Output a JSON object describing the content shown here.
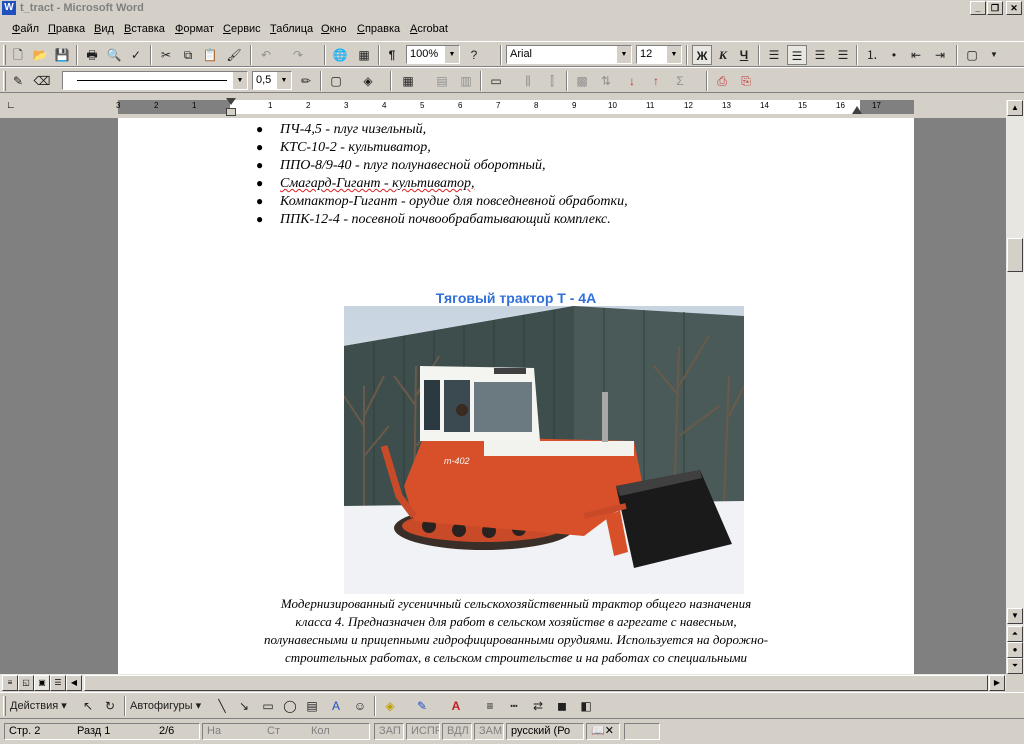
{
  "window": {
    "title": "t_tract - Microsoft Word",
    "icon_letter": "W"
  },
  "menu": [
    "Файл",
    "Правка",
    "Вид",
    "Вставка",
    "Формат",
    "Сервис",
    "Таблица",
    "Окно",
    "Справка",
    "Acrobat"
  ],
  "toolbar_standard": {
    "zoom": "100%",
    "font": "Arial",
    "font_size": "12",
    "bold": "Ж",
    "italic": "К",
    "underline": "Ч"
  },
  "toolbar_drawing_lines": {
    "line_weight": "0,5"
  },
  "ruler": {
    "ticks": [
      "3",
      "2",
      "1",
      "1",
      "2",
      "3",
      "4",
      "5",
      "6",
      "7",
      "8",
      "9",
      "10",
      "11",
      "12",
      "13",
      "14",
      "15",
      "16",
      "17"
    ]
  },
  "document": {
    "bullets": [
      "ПЧ-4,5 - плуг чизельный,",
      "КТС-10-2 - культиватор,",
      "ППО-8/9-40 - плуг полунавесной оборотный,",
      "Смагард-Гигант - культиватор,",
      "Компактор-Гигант - орудие для повседневной обработки,",
      "ППК-12-4 - посевной почвообрабатывающий комплекс."
    ],
    "heading": "Тяговый трактор Т - 4А",
    "tractor_plate": "т-402",
    "caption": [
      "Модернизированный гусеничный сельскохозяйственный трактор общего назначения",
      "класса 4. Предназначен для работ в сельском хозяйстве в агрегате с навесным,",
      "полунавесными и прицепными гидрофицированными орудиями. Используется на дорожно-",
      "строительных работах, в сельском строительстве и на работах со специальными"
    ]
  },
  "drawing_toolbar": {
    "actions": "Действия",
    "autoshapes": "Автофигуры"
  },
  "status": {
    "page": "Стр. 2",
    "section": "Разд 1",
    "pages": "2/6",
    "at": "На",
    "line": "Ст",
    "col": "Кол",
    "rec": "ЗАП",
    "trk": "ИСПР",
    "ext": "ВДЛ",
    "ovr": "ЗАМ",
    "language": "русский (Ро"
  },
  "colors": {
    "heading": "#3070d8",
    "chrome": "#d4d0c8",
    "tractor": "#d8502a"
  }
}
